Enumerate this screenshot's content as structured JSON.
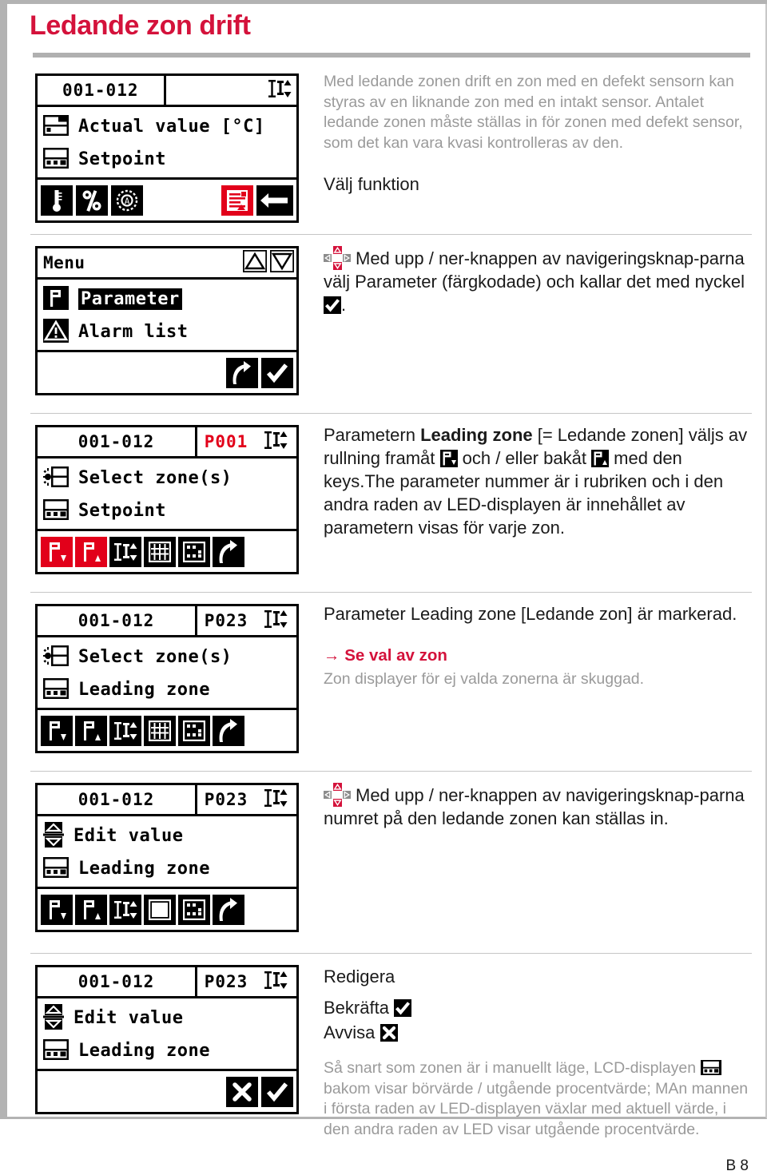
{
  "page": {
    "title": "Ledande zon drift",
    "footer_label": "B 8",
    "accent_red": "#d4123b",
    "lcd_red": "#e2001a",
    "gray_text": "#9a9a9a"
  },
  "sections": [
    {
      "id": "overview",
      "lcd": {
        "header": {
          "zone": "001-012",
          "param": "",
          "indicator": "II"
        },
        "rows": [
          {
            "icon": "lcd-actual-value-icon",
            "label": "Actual value [°C]"
          },
          {
            "icon": "lcd-setpoint-icon",
            "label": "Setpoint"
          }
        ],
        "toolbar": [
          "thermometer-icon",
          "percent-icon",
          "auto-mode-icon",
          "gap",
          "menu-list-icon-red",
          "key-icon"
        ]
      },
      "body": "Med ledande zonen drift en zon med en defekt sensorn kan styras av en liknande zon med en intakt sensor. Antalet ledande zonen måste ställas in för zonen med defekt sensor, som det kan vara kvasi kontrolleras av den.",
      "subheading": "Välj funktion",
      "instruction_pre": "Med upp / ner-knappen av navigeringsknap-parna välj Parameter (färgkodade) och kallar det med nyckel",
      "instruction_post": "."
    },
    {
      "id": "menu",
      "lcd": {
        "header": {
          "menu_title": "Menu",
          "buttons": [
            "up-triangle-icon",
            "down-triangle-icon"
          ]
        },
        "rows": [
          {
            "icon": "parameter-p-icon",
            "label": "Parameter",
            "selected": true
          },
          {
            "icon": "alarm-warning-icon",
            "label": "Alarm list",
            "selected": false
          }
        ],
        "toolbar": [
          "back-arrow-icon",
          "confirm-check-icon"
        ]
      }
    },
    {
      "id": "p001",
      "lcd": {
        "header": {
          "zone": "001-012",
          "param": "P001",
          "param_red": true,
          "indicator": "II"
        },
        "rows": [
          {
            "icon": "select-zones-icon",
            "label": "Select zone(s)"
          },
          {
            "icon": "lcd-setpoint-icon",
            "label": "Setpoint"
          }
        ],
        "toolbar": [
          "param-forward-icon-red",
          "param-back-icon-red",
          "zone-step-icon",
          "grid-all-icon",
          "grid-partial-icon",
          "back-arrow-icon"
        ]
      },
      "body_pre": "Parametern ",
      "body_bold": "Leading zone",
      "body_mid1": " [= Ledande zonen] väljs av rullning framåt ",
      "body_mid2": " och / eller bakåt ",
      "body_post": " med den keys.The parameter nummer är i rubriken och i den andra raden av LED-displayen är innehållet av parametern visas för varje zon."
    },
    {
      "id": "p023-select",
      "lcd": {
        "header": {
          "zone": "001-012",
          "param": "P023",
          "param_red": false,
          "indicator": "II"
        },
        "rows": [
          {
            "icon": "select-zones-icon",
            "label": "Select zone(s)"
          },
          {
            "icon": "lcd-setpoint-icon",
            "label": "Leading zone"
          }
        ],
        "toolbar": [
          "param-forward-icon",
          "param-back-icon",
          "zone-step-icon",
          "grid-all-icon",
          "grid-partial-icon",
          "back-arrow-icon"
        ]
      },
      "body": "Parameter Leading zone [Ledande zon] är markerad.",
      "cross_ref": "→ Se val av zon",
      "note": "Zon displayer för ej valda zonerna är skuggad."
    },
    {
      "id": "p023-edit",
      "lcd": {
        "header": {
          "zone": "001-012",
          "param": "P023",
          "param_red": false,
          "indicator": "II"
        },
        "rows": [
          {
            "icon": "edit-value-icon",
            "label": "Edit value"
          },
          {
            "icon": "lcd-setpoint-icon",
            "label": "Leading zone"
          }
        ],
        "toolbar": [
          "param-forward-icon",
          "param-back-icon",
          "zone-step-icon",
          "solid-block-icon",
          "grid-partial-icon",
          "back-arrow-icon"
        ]
      },
      "instruction": "Med upp / ner-knappen av navigeringsknap-parna numret på den ledande zonen kan ställas in."
    },
    {
      "id": "p023-confirm",
      "lcd": {
        "header": {
          "zone": "001-012",
          "param": "P023",
          "param_red": false,
          "indicator": "II"
        },
        "rows": [
          {
            "icon": "edit-value-icon",
            "label": "Edit value"
          },
          {
            "icon": "lcd-setpoint-icon",
            "label": "Leading zone"
          }
        ],
        "toolbar": [
          "reject-x-icon",
          "confirm-check-icon"
        ]
      },
      "heading": "Redigera",
      "confirm_label": "Bekräfta",
      "reject_label": "Avvisa",
      "note": "Så snart som zonen är i manuellt läge, LCD-displayen  bakom visar börvärde / utgående procentvärde; MAn mannen i första raden av LED-displayen växlar med aktuell värde, i den andra raden av LED visar utgående procentvärde.",
      "note_pre": "Så snart som zonen är i manuellt läge, LCD-displayen",
      "note_post": "bakom visar börvärde / utgående procentvärde; MAn mannen i första raden av LED-displayen växlar med aktuell värde, i den andra raden av LED visar utgående procentvärde."
    }
  ]
}
